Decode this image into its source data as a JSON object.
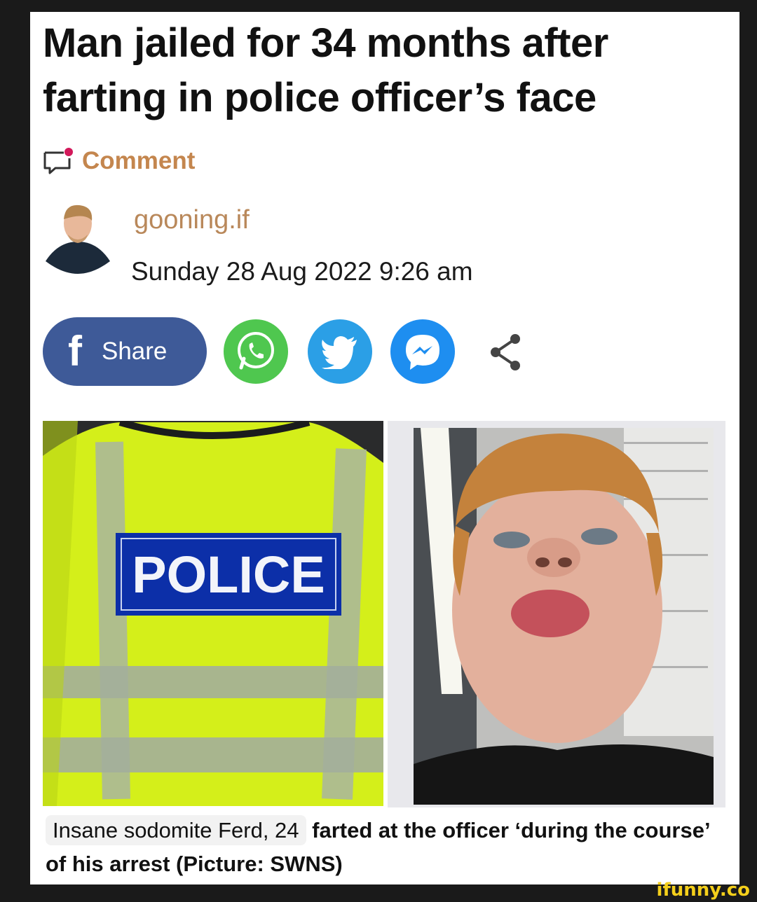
{
  "article": {
    "headline": "Man jailed for 34 months after farting in police officer’s face",
    "comment_label": "Comment",
    "author": "gooning.if",
    "date": "Sunday 28 Aug 2022 9:26 am"
  },
  "share": {
    "facebook_label": "Share",
    "buttons": [
      "facebook-icon",
      "whatsapp-icon",
      "twitter-icon",
      "messenger-icon",
      "share-icon"
    ]
  },
  "images": {
    "left_badge_text": "POLICE"
  },
  "caption": {
    "highlight": "Insane sodomite Ferd, 24",
    "rest": " farted at the officer ‘during the course’ of his arrest (Picture: SWNS)"
  },
  "watermark": "ifunny.co",
  "colors": {
    "comment_accent": "#c4864e",
    "author_accent": "#b9885a",
    "facebook": "#3e5a98",
    "whatsapp": "#4fc74f",
    "twitter": "#2b9fe6",
    "messenger": "#1e8ef0",
    "hi_vis": "#d8f21a"
  }
}
